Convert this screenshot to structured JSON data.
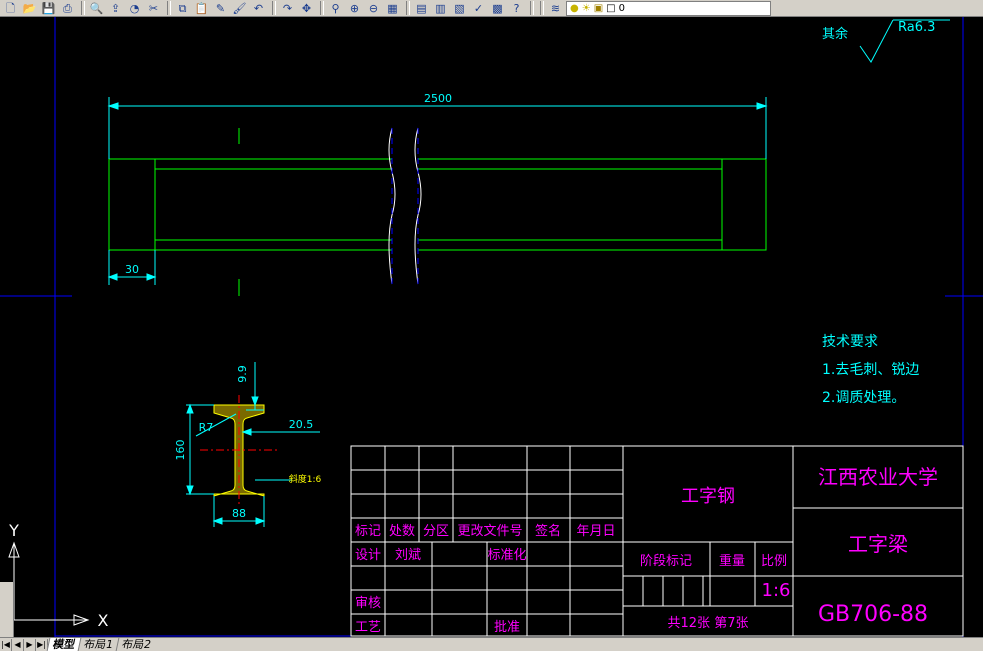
{
  "toolbar": {
    "tools": [
      "new-icon",
      "open-icon",
      "save-icon",
      "print-icon",
      "preview-icon",
      "publish-icon",
      "plot-icon",
      "cut-icon",
      "copy-icon",
      "paste-icon",
      "matchprop-icon",
      "brush-icon",
      "undo-icon",
      "redo-icon",
      "pan-icon",
      "zoom-realtime-icon",
      "zoom-window-icon",
      "zoom-previous-icon",
      "properties-icon",
      "designcenter-icon",
      "toolpalette-icon",
      "sheetset-icon",
      "markup-icon",
      "calculator-icon",
      "help-icon"
    ],
    "layer_value": "0"
  },
  "drawing": {
    "roughness_label": "其余",
    "roughness_value": "Ra6.3",
    "dim_length": "2500",
    "dim_end": "30",
    "section": {
      "dim_flange_thickness": "9.9",
      "dim_radius": "R7",
      "dim_web": "20.5",
      "dim_height": "160",
      "dim_width": "88",
      "slope_label": "斜度1:6"
    },
    "tech_title": "技术要求",
    "tech_items": [
      "1.去毛刺、锐边",
      "2.调质处理。"
    ]
  },
  "title_block": {
    "headers": [
      "标记",
      "处数",
      "分区",
      "更改文件号",
      "签名",
      "年月日"
    ],
    "design_label": "设计",
    "designer": "刘斌",
    "standardize_label": "标准化",
    "review_label": "审核",
    "process_label": "工艺",
    "approve_label": "批准",
    "material": "工字钢",
    "stage_label": "阶段标记",
    "weight_label": "重量",
    "scale_label": "比例",
    "scale_value": "1:6",
    "sheets": "共12张  第7张",
    "org": "江西农业大学",
    "part_name": "工字梁",
    "drawing_no": "GB706-88"
  },
  "ucs": {
    "y": "Y",
    "x": "X"
  },
  "tabs": {
    "model": "模型",
    "layout1": "布局1",
    "layout2": "布局2"
  },
  "colors": {
    "background": "#000000",
    "outline": "#00ff00",
    "dimension": "#00ffff",
    "title_text": "#ff00ff",
    "border": "#0000ff",
    "frame": "#ffffff"
  }
}
